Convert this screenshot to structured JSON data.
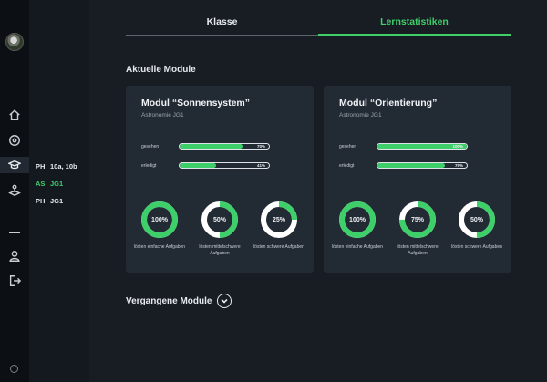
{
  "nav": {
    "icons": [
      "home-icon",
      "target-icon",
      "graduation-cap-icon",
      "joystick-icon",
      "user-icon",
      "logout-icon",
      "globe-icon"
    ],
    "active": "graduation-cap-icon"
  },
  "classes": [
    {
      "subject": "PH",
      "group": "10a, 10b",
      "active": false
    },
    {
      "subject": "AS",
      "group": "JG1",
      "active": true
    },
    {
      "subject": "PH",
      "group": "JG1",
      "active": false
    }
  ],
  "tabs": [
    {
      "label": "Klasse",
      "active": false
    },
    {
      "label": "Lernstatistiken",
      "active": true
    }
  ],
  "current_section": "Aktuelle Module",
  "past_section": "Vergangene Module",
  "colors": {
    "accent": "#3fcf6a",
    "card": "#222a34",
    "background": "#181d24"
  },
  "modules": [
    {
      "title": "Modul “Sonnensystem”",
      "subtitle": "Astronomie JG1",
      "bars": [
        {
          "label": "gesehen",
          "value": 70,
          "text": "70%"
        },
        {
          "label": "erledigt",
          "value": 41,
          "text": "41%"
        }
      ],
      "rings": [
        {
          "value": 100,
          "text": "100%",
          "label": "lösten einfache Aufgaben"
        },
        {
          "value": 50,
          "text": "50%",
          "label": "lösten mittelschwere Aufgaben"
        },
        {
          "value": 25,
          "text": "25%",
          "label": "lösten schwere Aufgaben"
        }
      ]
    },
    {
      "title": "Modul “Orientierung”",
      "subtitle": "Astronomie JG1",
      "bars": [
        {
          "label": "gesehen",
          "value": 100,
          "text": "100%"
        },
        {
          "label": "erledigt",
          "value": 75,
          "text": "75%"
        }
      ],
      "rings": [
        {
          "value": 100,
          "text": "100%",
          "label": "lösten einfache Aufgaben"
        },
        {
          "value": 75,
          "text": "75%",
          "label": "lösten mittelschwere Aufgaben"
        },
        {
          "value": 50,
          "text": "50%",
          "label": "lösten schwere Aufgaben"
        }
      ]
    }
  ]
}
